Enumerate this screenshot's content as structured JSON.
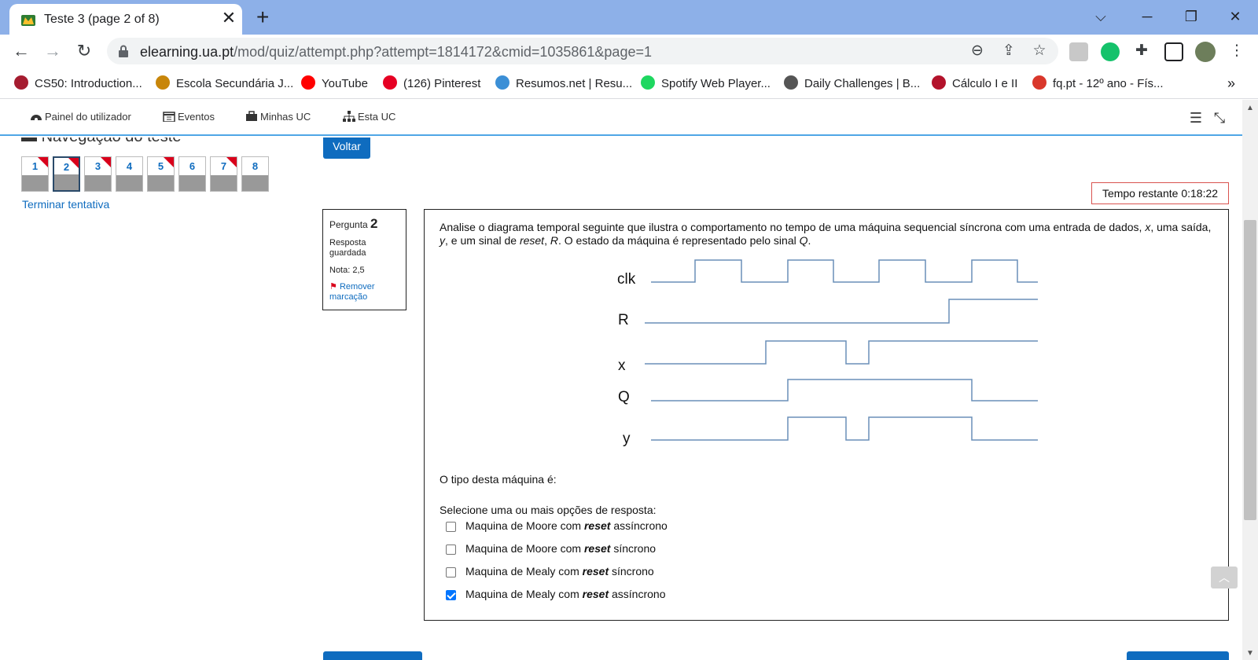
{
  "browser": {
    "tab_title": "Teste 3 (page 2 of 8)",
    "tab_close": "✕",
    "new_tab": "+",
    "url_host": "elearning.ua.pt",
    "url_path": "/mod/quiz/attempt.php?attempt=1814172&cmid=1035861&page=1",
    "bookmarks": [
      {
        "label": "CS50: Introduction...",
        "color": "#a51c30"
      },
      {
        "label": "Escola Secundária J...",
        "color": "#c8860a"
      },
      {
        "label": "YouTube",
        "color": "#ff0000"
      },
      {
        "label": "(126) Pinterest",
        "color": "#e60023"
      },
      {
        "label": "Resumos.net | Resu...",
        "color": "#3b8fd6"
      },
      {
        "label": "Spotify Web Player...",
        "color": "#1ed760"
      },
      {
        "label": "Daily Challenges | B...",
        "color": "#555555"
      },
      {
        "label": "Cálculo I e II",
        "color": "#b3122b"
      },
      {
        "label": "fq.pt - 12º ano - Fís...",
        "color": "#d9372b"
      }
    ],
    "bookmarks_overflow": "»"
  },
  "navbar": {
    "items": [
      "Painel do utilizador",
      "Eventos",
      "Minhas UC",
      "Esta UC"
    ]
  },
  "quiz_nav": {
    "title": "Navegação do teste",
    "buttons": [
      {
        "label": "1",
        "flagged": true,
        "current": false
      },
      {
        "label": "2",
        "flagged": true,
        "current": true
      },
      {
        "label": "3",
        "flagged": true,
        "current": false
      },
      {
        "label": "4",
        "flagged": false,
        "current": false
      },
      {
        "label": "5",
        "flagged": true,
        "current": false
      },
      {
        "label": "6",
        "flagged": false,
        "current": false
      },
      {
        "label": "7",
        "flagged": true,
        "current": false
      },
      {
        "label": "8",
        "flagged": false,
        "current": false
      }
    ],
    "finish_link": "Terminar tentativa"
  },
  "back_button": "Voltar",
  "timer": "Tempo restante 0:18:22",
  "question_info": {
    "label": "Pergunta",
    "number": "2",
    "state": "Resposta guardada",
    "grade": "Nota: 2,5",
    "flag_link": "Remover marcação"
  },
  "question": {
    "text_p1": "Analise o diagrama temporal seguinte que ilustra o comportamento no tempo de uma máquina sequencial síncrona com uma entrada de dados, ",
    "text_x": "x",
    "text_p2": ", uma saída, ",
    "text_y": "y",
    "text_p3": ", e um sinal de ",
    "text_reset": "reset",
    "text_p4": ", ",
    "text_R": "R",
    "text_p5": ".  O estado da máquina é representado pelo sinal ",
    "text_Q": "Q",
    "text_p6": ".",
    "signals": [
      "clk",
      "R",
      "x",
      "Q",
      "y"
    ],
    "prompt": "O tipo desta máquina é:",
    "select_prompt": "Selecione uma ou mais opções de resposta:",
    "options": [
      {
        "pre": "Maquina de Moore com ",
        "em": "reset",
        "post": " assíncrono",
        "checked": false
      },
      {
        "pre": "Maquina de Moore com ",
        "em": "reset",
        "post": " síncrono",
        "checked": false
      },
      {
        "pre": "Maquina de Mealy com ",
        "em": "reset",
        "post": " síncrono",
        "checked": false
      },
      {
        "pre": "Maquina de Mealy com ",
        "em": "reset",
        "post": " assíncrono",
        "checked": true
      }
    ]
  },
  "colors": {
    "accent": "#0f6cbf",
    "waveform": "#6a8fb8",
    "flag": "#d9001b",
    "timer_border": "#d9534f"
  }
}
